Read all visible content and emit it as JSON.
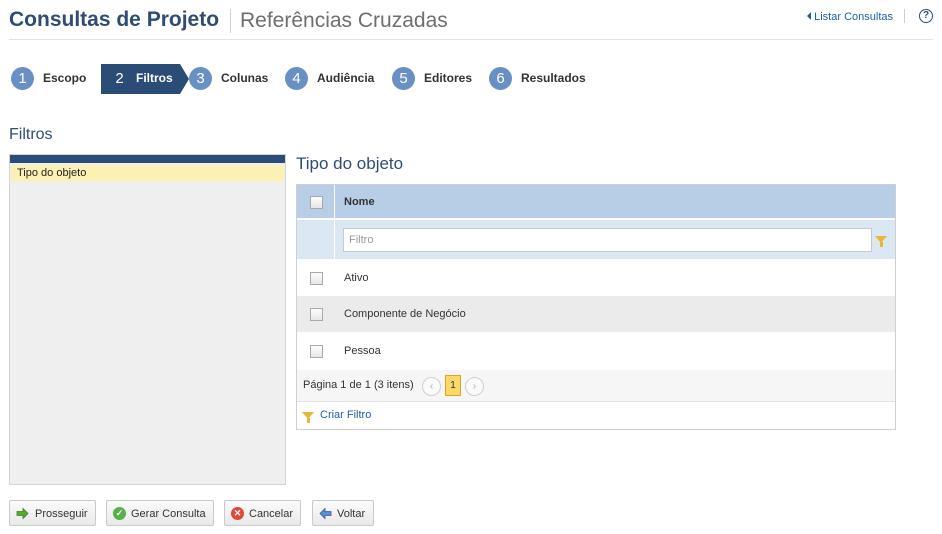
{
  "header": {
    "title": "Consultas de Projeto",
    "subtitle": "Referências Cruzadas",
    "list_link": "Listar Consultas",
    "help_glyph": "?"
  },
  "steps": [
    {
      "num": "1",
      "label": "Escopo"
    },
    {
      "num": "2",
      "label": "Filtros",
      "active": true
    },
    {
      "num": "3",
      "label": "Colunas"
    },
    {
      "num": "4",
      "label": "Audiência"
    },
    {
      "num": "5",
      "label": "Editores"
    },
    {
      "num": "6",
      "label": "Resultados"
    }
  ],
  "section_title": "Filtros",
  "filter_list": {
    "items": [
      "Tipo do objeto"
    ]
  },
  "object_type": {
    "title": "Tipo do objeto",
    "column_header": "Nome",
    "filter_placeholder": "Filtro",
    "rows": [
      "Ativo",
      "Componente de Negócio",
      "Pessoa"
    ],
    "pager": {
      "text": "Página 1 de 1 (3 itens)",
      "current": "1",
      "prev": "‹",
      "next": "›"
    },
    "create_filter": "Criar Filtro"
  },
  "buttons": {
    "proceed": "Prosseguir",
    "generate": "Gerar Consulta",
    "cancel": "Cancelar",
    "back": "Voltar"
  },
  "colors": {
    "accent": "#2b4c76",
    "step_circle": "#6a8fc2",
    "link": "#1f5fa8",
    "selected_row": "#fdf0b4",
    "header_blue": "#b8cde6"
  }
}
